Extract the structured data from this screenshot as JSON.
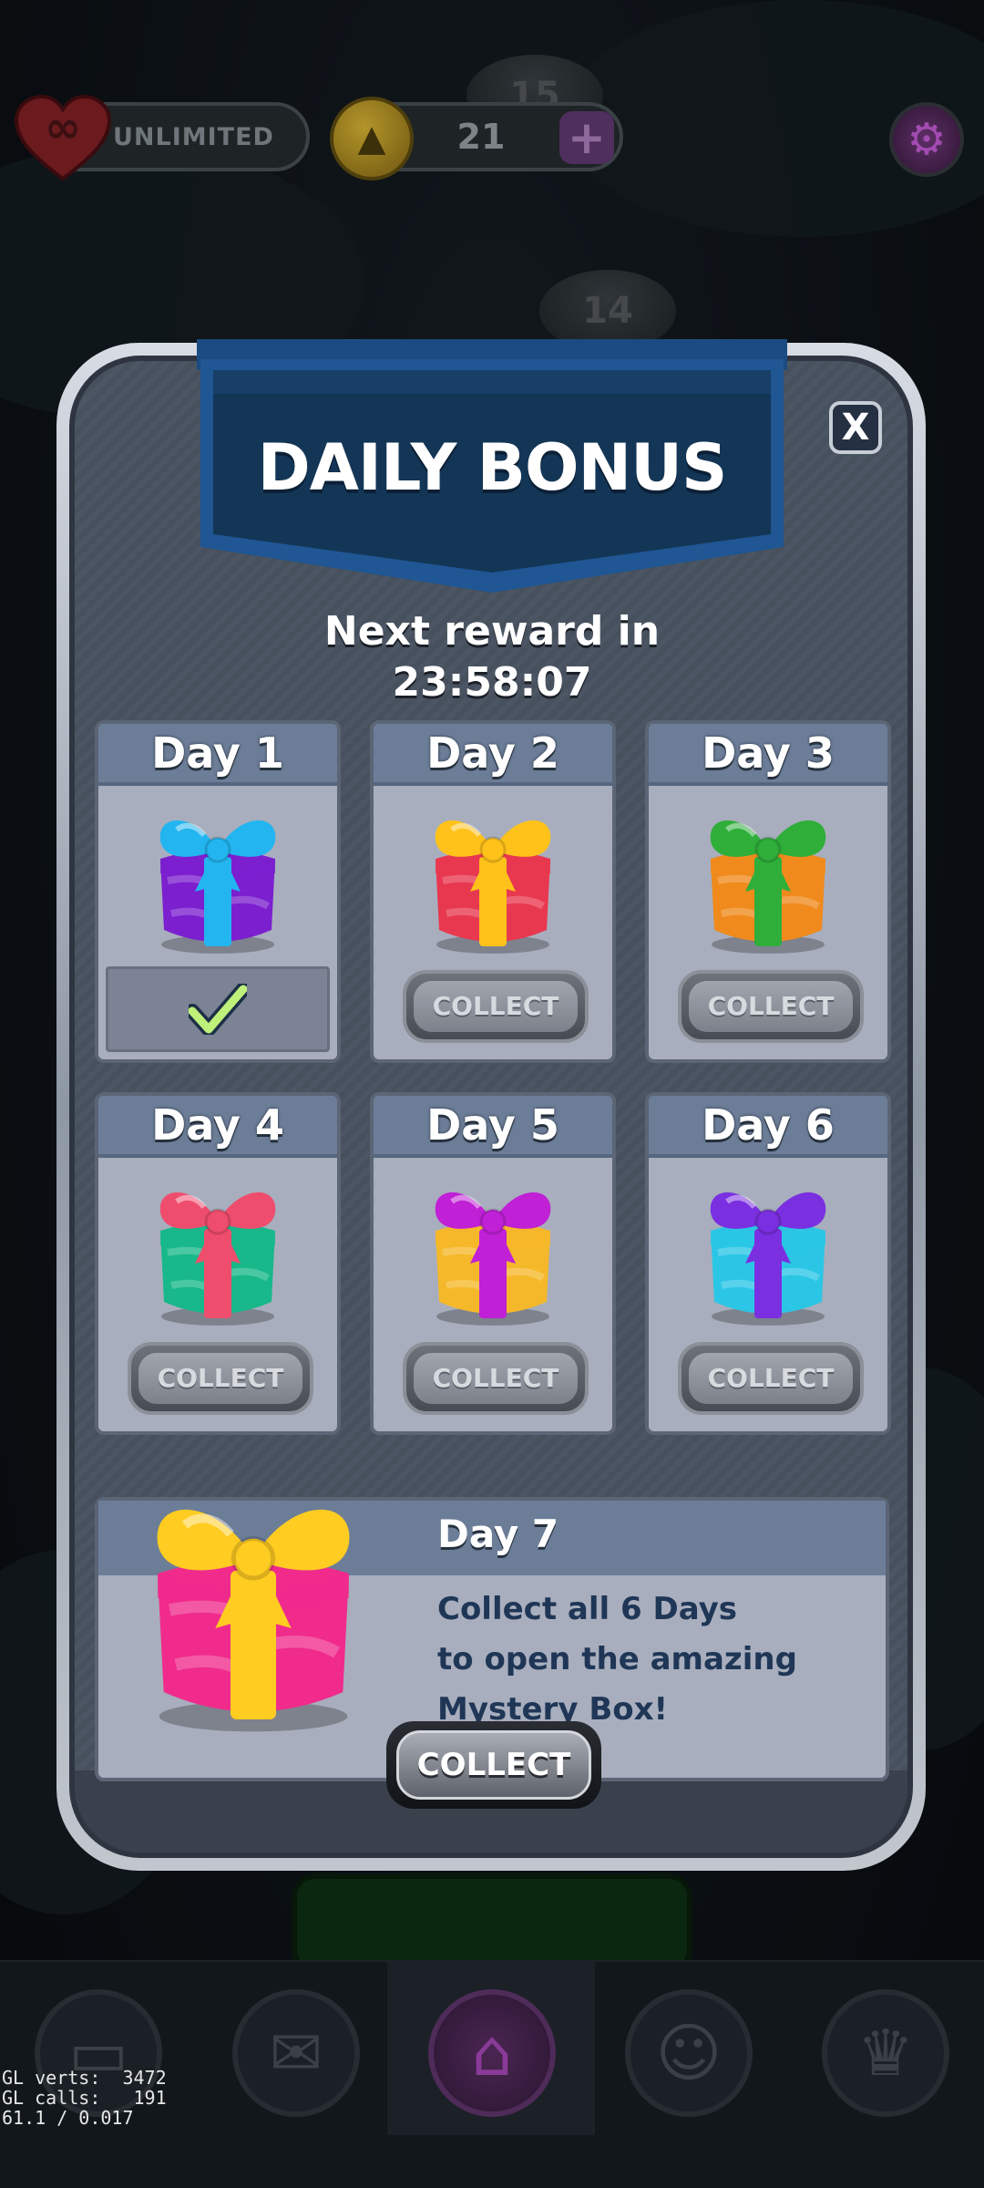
{
  "hud": {
    "lives_label": "UNLIMITED",
    "lives_icon": "infinity-heart-icon",
    "coins_value": "21",
    "coin_icon": "coin-icon",
    "add_icon": "plus-icon",
    "settings_icon": "gear-icon"
  },
  "board": {
    "node_15": "15",
    "node_14": "14"
  },
  "modal": {
    "title": "DAILY BONUS",
    "next_reward_label": "Next reward in",
    "next_reward_timer": "23:58:07",
    "close_label": "X",
    "days": [
      {
        "label": "Day 1",
        "state": "claimed",
        "gift_colors": [
          "#7b1fcf",
          "#23b5f0"
        ]
      },
      {
        "label": "Day 2",
        "state": "collect",
        "button": "COLLECT",
        "gift_colors": [
          "#e8384f",
          "#ffc21a"
        ]
      },
      {
        "label": "Day 3",
        "state": "collect",
        "button": "COLLECT",
        "gift_colors": [
          "#f08a1c",
          "#2fae3a"
        ]
      },
      {
        "label": "Day 4",
        "state": "collect",
        "button": "COLLECT",
        "gift_colors": [
          "#18b88a",
          "#ef4d6d"
        ]
      },
      {
        "label": "Day 5",
        "state": "collect",
        "button": "COLLECT",
        "gift_colors": [
          "#f5b82a",
          "#c020d6"
        ]
      },
      {
        "label": "Day 6",
        "state": "collect",
        "button": "COLLECT",
        "gift_colors": [
          "#2bc6e6",
          "#7a2fe0"
        ]
      }
    ],
    "day7": {
      "label": "Day 7",
      "desc_lines": [
        "Collect all 6 Days",
        "to open the amazing",
        "Mystery Box!"
      ],
      "button": "COLLECT",
      "gift_colors": [
        "#f02b8c",
        "#ffcc22"
      ]
    }
  },
  "nav": {
    "items": [
      "cards-icon",
      "mail-icon",
      "home-icon",
      "friends-icon",
      "trophy-icon"
    ]
  },
  "debug": {
    "line1": "GL verts:  3472",
    "line2": "GL calls:   191",
    "line3": "61.1 / 0.017"
  },
  "colors": {
    "accent_blue": "#1f4e86",
    "panel_bg": "#a8aebd",
    "day_header": "#6c7d98"
  }
}
